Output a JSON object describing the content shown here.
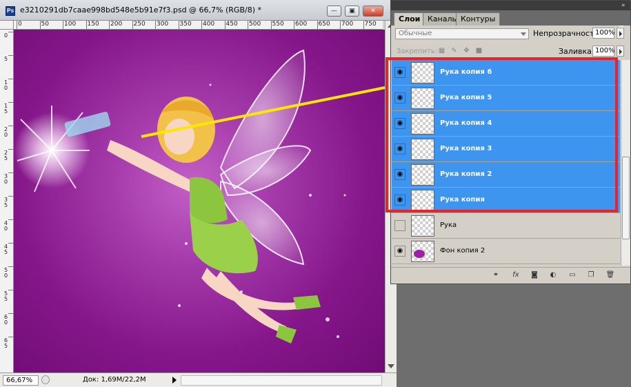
{
  "document": {
    "title": "e3210291db7caae998bd548e5b91e7f3.psd @ 66,7% (RGB/8) *",
    "app_logo": "Ps",
    "ruler_top_labels": [
      "0",
      "50",
      "100",
      "150",
      "200",
      "250",
      "300",
      "350",
      "400",
      "450",
      "500",
      "550",
      "600",
      "650",
      "700",
      "750"
    ],
    "ruler_left_labels": [
      "0",
      "5",
      "10",
      "15",
      "20",
      "25",
      "30",
      "35",
      "40",
      "45",
      "50",
      "55",
      "60",
      "65"
    ],
    "status": {
      "zoom": "66,67%",
      "doc_info": "Док: 1,69M/22,2M"
    }
  },
  "layers_panel": {
    "tabs": [
      {
        "label": "Слои",
        "active": true
      },
      {
        "label": "Каналы",
        "active": false
      },
      {
        "label": "Контуры",
        "active": false
      }
    ],
    "blend_mode": "Обычные",
    "opacity_label": "Непрозрачность:",
    "opacity_value": "100%",
    "lock_label": "Закрепить:",
    "fill_label": "Заливка:",
    "fill_value": "100%",
    "layers": [
      {
        "name": "Рука копия 6",
        "selected": true,
        "visible": true,
        "thumb": "transparent"
      },
      {
        "name": "Рука копия 5",
        "selected": true,
        "visible": true,
        "thumb": "transparent"
      },
      {
        "name": "Рука копия 4",
        "selected": true,
        "visible": true,
        "thumb": "transparent"
      },
      {
        "name": "Рука копия 3",
        "selected": true,
        "visible": true,
        "thumb": "transparent"
      },
      {
        "name": "Рука копия 2",
        "selected": true,
        "visible": true,
        "thumb": "transparent"
      },
      {
        "name": "Рука копия",
        "selected": true,
        "visible": true,
        "thumb": "transparent"
      },
      {
        "name": "Рука",
        "selected": false,
        "visible": false,
        "thumb": "transparent"
      },
      {
        "name": "Фон копия 2",
        "selected": false,
        "visible": true,
        "thumb": "purple"
      },
      {
        "name": "",
        "selected": false,
        "visible": true,
        "thumb": "purple"
      }
    ],
    "footer_icons": [
      "link-icon",
      "fx-icon",
      "mask-icon",
      "adjustment-icon",
      "group-icon",
      "new-layer-icon",
      "trash-icon"
    ]
  },
  "colors": {
    "selection_blue": "#3d95f0",
    "highlight_red": "#e8232c",
    "annotation_yellow": "#ffe600",
    "canvas_purple": "#85168a"
  }
}
